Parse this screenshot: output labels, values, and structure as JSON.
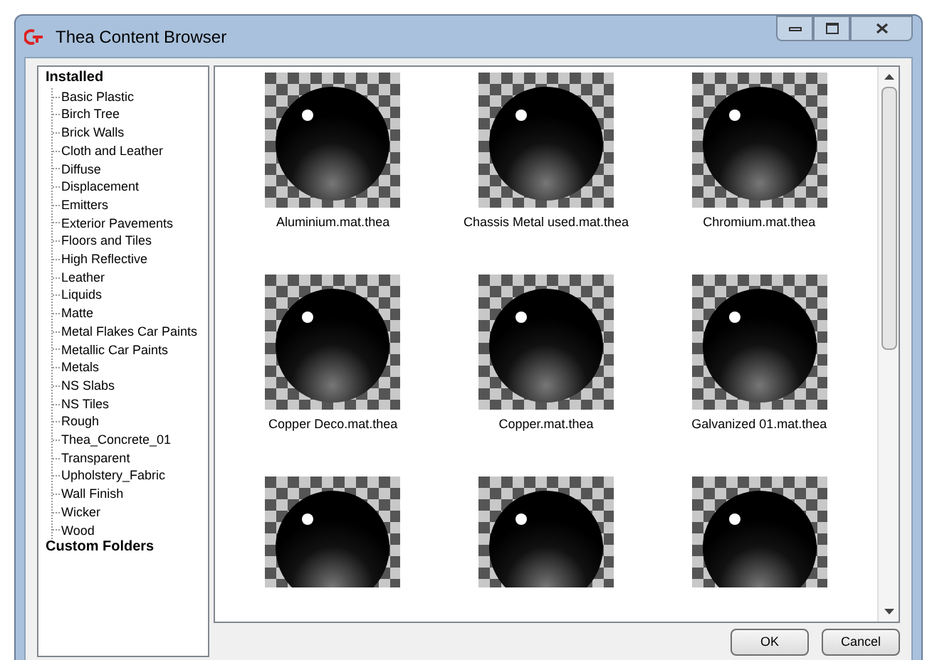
{
  "window": {
    "title": "Thea Content Browser"
  },
  "tree": [
    {
      "label": "Installed",
      "children": [
        {
          "label": "Basic Plastic"
        },
        {
          "label": "Birch Tree"
        },
        {
          "label": "Brick Walls"
        },
        {
          "label": "Cloth and Leather"
        },
        {
          "label": "Diffuse"
        },
        {
          "label": "Displacement"
        },
        {
          "label": "Emitters"
        },
        {
          "label": "Exterior Pavements"
        },
        {
          "label": "Floors and Tiles"
        },
        {
          "label": "High Reflective"
        },
        {
          "label": "Leather"
        },
        {
          "label": "Liquids"
        },
        {
          "label": "Matte"
        },
        {
          "label": "Metal Flakes Car Paints"
        },
        {
          "label": "Metallic Car Paints"
        },
        {
          "label": "Metals"
        },
        {
          "label": "NS Slabs"
        },
        {
          "label": "NS Tiles"
        },
        {
          "label": "Rough"
        },
        {
          "label": "Thea_Concrete_01"
        },
        {
          "label": "Transparent"
        },
        {
          "label": "Upholstery_Fabric"
        },
        {
          "label": "Wall Finish"
        },
        {
          "label": "Wicker"
        },
        {
          "label": "Wood"
        }
      ]
    },
    {
      "label": "Custom Folders"
    }
  ],
  "thumbnails": [
    {
      "kind": "labeled",
      "label": "Aluminium.mat.thea"
    },
    {
      "kind": "labeled",
      "label": "Chassis Metal used.mat.thea"
    },
    {
      "kind": "labeled",
      "label": "Chromium.mat.thea"
    },
    {
      "kind": "labeled",
      "label": "Copper Deco.mat.thea"
    },
    {
      "kind": "labeled",
      "label": "Copper.mat.thea"
    },
    {
      "kind": "labeled",
      "label": "Galvanized 01.mat.thea"
    },
    {
      "kind": "cut_off"
    },
    {
      "kind": "cut_off"
    },
    {
      "kind": "cut_off"
    }
  ],
  "buttons": [
    "OK",
    "Cancel"
  ]
}
